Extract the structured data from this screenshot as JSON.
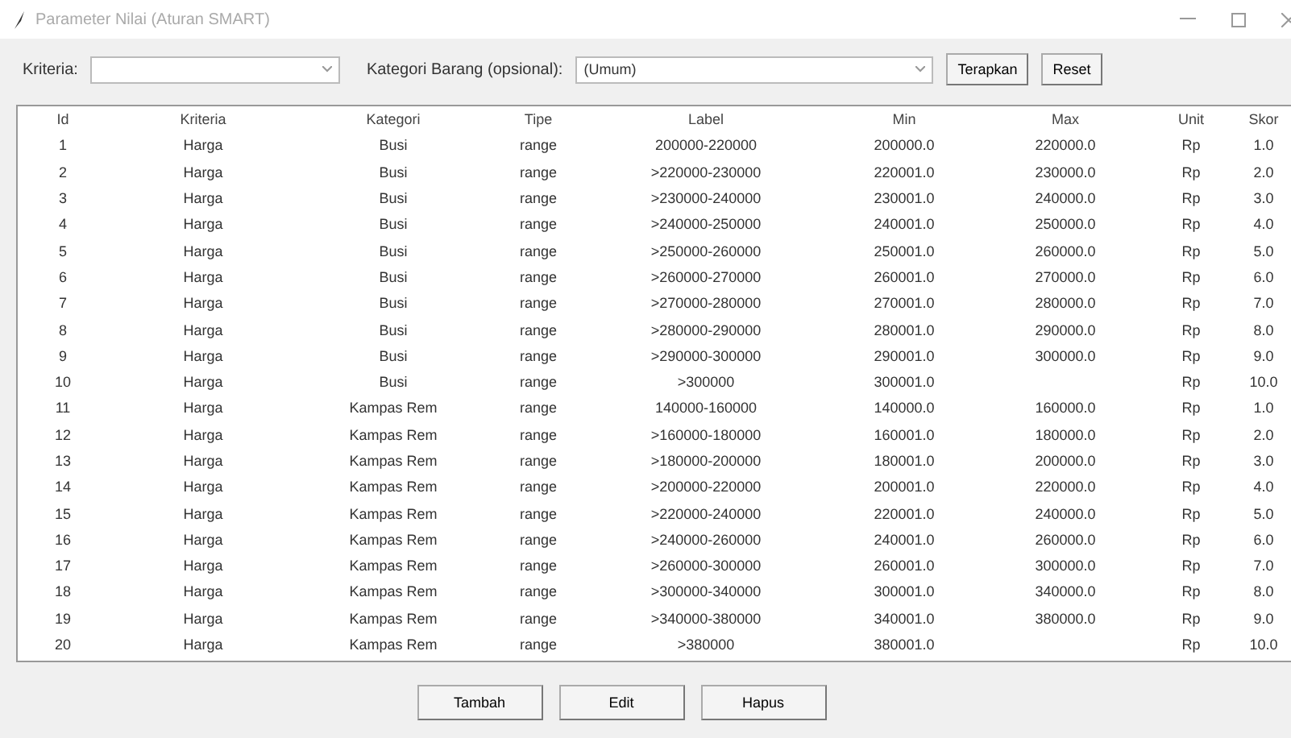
{
  "window": {
    "title": "Parameter Nilai (Aturan SMART)"
  },
  "filter": {
    "criteria_label": "Kriteria:",
    "category_label": "Kategori Barang (opsional):",
    "category_value": "(Umum)",
    "buttons": [
      "Terapkan",
      "Reset"
    ]
  },
  "table": {
    "columns": [
      "Id",
      "Kriteria",
      "Kategori",
      "Tipe",
      "Label",
      "Min",
      "Max",
      "Unit",
      "Skor"
    ],
    "rows": [
      [
        "1",
        "Harga",
        "Busi",
        "range",
        "200000-220000",
        "200000.0",
        "220000.0",
        "Rp",
        "1.0"
      ],
      [
        "2",
        "Harga",
        "Busi",
        "range",
        ">220000-230000",
        "220001.0",
        "230000.0",
        "Rp",
        "2.0"
      ],
      [
        "3",
        "Harga",
        "Busi",
        "range",
        ">230000-240000",
        "230001.0",
        "240000.0",
        "Rp",
        "3.0"
      ],
      [
        "4",
        "Harga",
        "Busi",
        "range",
        ">240000-250000",
        "240001.0",
        "250000.0",
        "Rp",
        "4.0"
      ],
      [
        "5",
        "Harga",
        "Busi",
        "range",
        ">250000-260000",
        "250001.0",
        "260000.0",
        "Rp",
        "5.0"
      ],
      [
        "6",
        "Harga",
        "Busi",
        "range",
        ">260000-270000",
        "260001.0",
        "270000.0",
        "Rp",
        "6.0"
      ],
      [
        "7",
        "Harga",
        "Busi",
        "range",
        ">270000-280000",
        "270001.0",
        "280000.0",
        "Rp",
        "7.0"
      ],
      [
        "8",
        "Harga",
        "Busi",
        "range",
        ">280000-290000",
        "280001.0",
        "290000.0",
        "Rp",
        "8.0"
      ],
      [
        "9",
        "Harga",
        "Busi",
        "range",
        ">290000-300000",
        "290001.0",
        "300000.0",
        "Rp",
        "9.0"
      ],
      [
        "10",
        "Harga",
        "Busi",
        "range",
        ">300000",
        "300001.0",
        "",
        "Rp",
        "10.0"
      ],
      [
        "11",
        "Harga",
        "Kampas Rem",
        "range",
        "140000-160000",
        "140000.0",
        "160000.0",
        "Rp",
        "1.0"
      ],
      [
        "12",
        "Harga",
        "Kampas Rem",
        "range",
        ">160000-180000",
        "160001.0",
        "180000.0",
        "Rp",
        "2.0"
      ],
      [
        "13",
        "Harga",
        "Kampas Rem",
        "range",
        ">180000-200000",
        "180001.0",
        "200000.0",
        "Rp",
        "3.0"
      ],
      [
        "14",
        "Harga",
        "Kampas Rem",
        "range",
        ">200000-220000",
        "200001.0",
        "220000.0",
        "Rp",
        "4.0"
      ],
      [
        "15",
        "Harga",
        "Kampas Rem",
        "range",
        ">220000-240000",
        "220001.0",
        "240000.0",
        "Rp",
        "5.0"
      ],
      [
        "16",
        "Harga",
        "Kampas Rem",
        "range",
        ">240000-260000",
        "240001.0",
        "260000.0",
        "Rp",
        "6.0"
      ],
      [
        "17",
        "Harga",
        "Kampas Rem",
        "range",
        ">260000-300000",
        "260001.0",
        "300000.0",
        "Rp",
        "7.0"
      ],
      [
        "18",
        "Harga",
        "Kampas Rem",
        "range",
        ">300000-340000",
        "300001.0",
        "340000.0",
        "Rp",
        "8.0"
      ],
      [
        "19",
        "Harga",
        "Kampas Rem",
        "range",
        ">340000-380000",
        "340001.0",
        "380000.0",
        "Rp",
        "9.0"
      ],
      [
        "20",
        "Harga",
        "Kampas Rem",
        "range",
        ">380000",
        "380001.0",
        "",
        "Rp",
        "10.0"
      ]
    ]
  },
  "actions": [
    "Tambah",
    "Edit",
    "Hapus"
  ]
}
